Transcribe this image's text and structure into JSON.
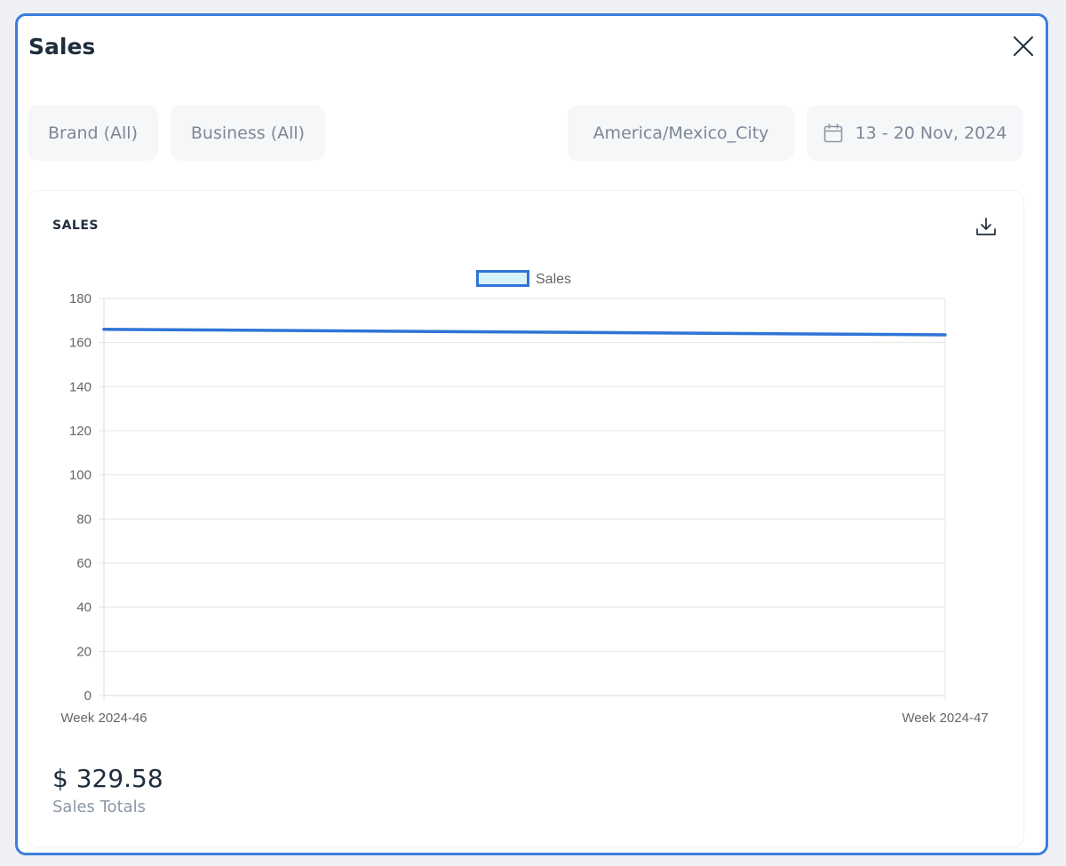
{
  "modal": {
    "title": "Sales"
  },
  "filters": {
    "brand": "Brand (All)",
    "business": "Business (All)",
    "timezone": "America/Mexico_City",
    "date_range": "13 - 20 Nov, 2024"
  },
  "card": {
    "title": "SALES",
    "total_value": "$ 329.58",
    "total_label": "Sales Totals"
  },
  "icons": {
    "close": "close-icon",
    "calendar": "calendar-icon",
    "download": "download-icon"
  },
  "colors": {
    "accent": "#3b7ddd",
    "series_line": "#2f74d6",
    "legend_fill": "#d6f1f7",
    "grid": "#e5e5e5",
    "tick_text": "#666666"
  },
  "chart_data": {
    "type": "line",
    "categories": [
      "Week 2024-46",
      "Week 2024-47"
    ],
    "series": [
      {
        "name": "Sales",
        "values": [
          166,
          163.5
        ]
      }
    ],
    "ylim": [
      0,
      180
    ],
    "yticks": [
      0,
      20,
      40,
      60,
      80,
      100,
      120,
      140,
      160,
      180
    ],
    "grid": true,
    "legend": "top-center"
  }
}
